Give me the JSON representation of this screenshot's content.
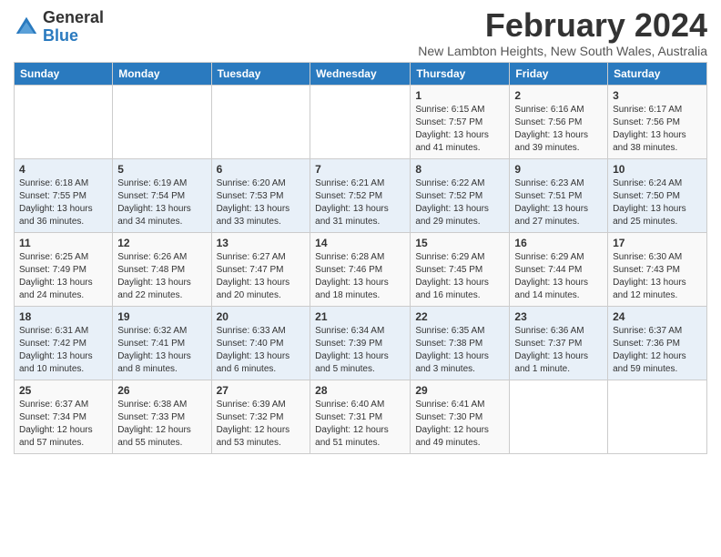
{
  "logo": {
    "line1": "General",
    "line2": "Blue"
  },
  "title": "February 2024",
  "location": "New Lambton Heights, New South Wales, Australia",
  "days_of_week": [
    "Sunday",
    "Monday",
    "Tuesday",
    "Wednesday",
    "Thursday",
    "Friday",
    "Saturday"
  ],
  "weeks": [
    [
      {
        "day": "",
        "content": ""
      },
      {
        "day": "",
        "content": ""
      },
      {
        "day": "",
        "content": ""
      },
      {
        "day": "",
        "content": ""
      },
      {
        "day": "1",
        "content": "Sunrise: 6:15 AM\nSunset: 7:57 PM\nDaylight: 13 hours and 41 minutes."
      },
      {
        "day": "2",
        "content": "Sunrise: 6:16 AM\nSunset: 7:56 PM\nDaylight: 13 hours and 39 minutes."
      },
      {
        "day": "3",
        "content": "Sunrise: 6:17 AM\nSunset: 7:56 PM\nDaylight: 13 hours and 38 minutes."
      }
    ],
    [
      {
        "day": "4",
        "content": "Sunrise: 6:18 AM\nSunset: 7:55 PM\nDaylight: 13 hours and 36 minutes."
      },
      {
        "day": "5",
        "content": "Sunrise: 6:19 AM\nSunset: 7:54 PM\nDaylight: 13 hours and 34 minutes."
      },
      {
        "day": "6",
        "content": "Sunrise: 6:20 AM\nSunset: 7:53 PM\nDaylight: 13 hours and 33 minutes."
      },
      {
        "day": "7",
        "content": "Sunrise: 6:21 AM\nSunset: 7:52 PM\nDaylight: 13 hours and 31 minutes."
      },
      {
        "day": "8",
        "content": "Sunrise: 6:22 AM\nSunset: 7:52 PM\nDaylight: 13 hours and 29 minutes."
      },
      {
        "day": "9",
        "content": "Sunrise: 6:23 AM\nSunset: 7:51 PM\nDaylight: 13 hours and 27 minutes."
      },
      {
        "day": "10",
        "content": "Sunrise: 6:24 AM\nSunset: 7:50 PM\nDaylight: 13 hours and 25 minutes."
      }
    ],
    [
      {
        "day": "11",
        "content": "Sunrise: 6:25 AM\nSunset: 7:49 PM\nDaylight: 13 hours and 24 minutes."
      },
      {
        "day": "12",
        "content": "Sunrise: 6:26 AM\nSunset: 7:48 PM\nDaylight: 13 hours and 22 minutes."
      },
      {
        "day": "13",
        "content": "Sunrise: 6:27 AM\nSunset: 7:47 PM\nDaylight: 13 hours and 20 minutes."
      },
      {
        "day": "14",
        "content": "Sunrise: 6:28 AM\nSunset: 7:46 PM\nDaylight: 13 hours and 18 minutes."
      },
      {
        "day": "15",
        "content": "Sunrise: 6:29 AM\nSunset: 7:45 PM\nDaylight: 13 hours and 16 minutes."
      },
      {
        "day": "16",
        "content": "Sunrise: 6:29 AM\nSunset: 7:44 PM\nDaylight: 13 hours and 14 minutes."
      },
      {
        "day": "17",
        "content": "Sunrise: 6:30 AM\nSunset: 7:43 PM\nDaylight: 13 hours and 12 minutes."
      }
    ],
    [
      {
        "day": "18",
        "content": "Sunrise: 6:31 AM\nSunset: 7:42 PM\nDaylight: 13 hours and 10 minutes."
      },
      {
        "day": "19",
        "content": "Sunrise: 6:32 AM\nSunset: 7:41 PM\nDaylight: 13 hours and 8 minutes."
      },
      {
        "day": "20",
        "content": "Sunrise: 6:33 AM\nSunset: 7:40 PM\nDaylight: 13 hours and 6 minutes."
      },
      {
        "day": "21",
        "content": "Sunrise: 6:34 AM\nSunset: 7:39 PM\nDaylight: 13 hours and 5 minutes."
      },
      {
        "day": "22",
        "content": "Sunrise: 6:35 AM\nSunset: 7:38 PM\nDaylight: 13 hours and 3 minutes."
      },
      {
        "day": "23",
        "content": "Sunrise: 6:36 AM\nSunset: 7:37 PM\nDaylight: 13 hours and 1 minute."
      },
      {
        "day": "24",
        "content": "Sunrise: 6:37 AM\nSunset: 7:36 PM\nDaylight: 12 hours and 59 minutes."
      }
    ],
    [
      {
        "day": "25",
        "content": "Sunrise: 6:37 AM\nSunset: 7:34 PM\nDaylight: 12 hours and 57 minutes."
      },
      {
        "day": "26",
        "content": "Sunrise: 6:38 AM\nSunset: 7:33 PM\nDaylight: 12 hours and 55 minutes."
      },
      {
        "day": "27",
        "content": "Sunrise: 6:39 AM\nSunset: 7:32 PM\nDaylight: 12 hours and 53 minutes."
      },
      {
        "day": "28",
        "content": "Sunrise: 6:40 AM\nSunset: 7:31 PM\nDaylight: 12 hours and 51 minutes."
      },
      {
        "day": "29",
        "content": "Sunrise: 6:41 AM\nSunset: 7:30 PM\nDaylight: 12 hours and 49 minutes."
      },
      {
        "day": "",
        "content": ""
      },
      {
        "day": "",
        "content": ""
      }
    ]
  ]
}
